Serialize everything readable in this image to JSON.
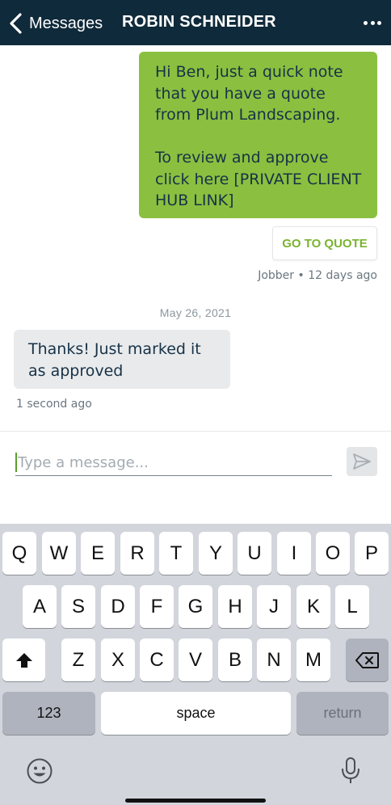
{
  "header": {
    "back_label": "Messages",
    "title": "ROBIN SCHNEIDER"
  },
  "conversation": {
    "outgoing_message": "Hi Ben, just a quick note that you have a quote from Plum Landscaping.\n\nTo review and approve click here [PRIVATE CLIENT HUB LINK]",
    "quote_button_label": "GO TO QUOTE",
    "outgoing_meta": "Jobber • 12 days ago",
    "date_separator": "May 26, 2021",
    "incoming_message": "Thanks! Just marked it as approved",
    "incoming_meta": "1 second ago"
  },
  "composer": {
    "placeholder": "Type a message..."
  },
  "keyboard": {
    "row1": [
      "Q",
      "W",
      "E",
      "R",
      "T",
      "Y",
      "U",
      "I",
      "O",
      "P"
    ],
    "row2": [
      "A",
      "S",
      "D",
      "F",
      "G",
      "H",
      "J",
      "K",
      "L"
    ],
    "row3": [
      "Z",
      "X",
      "C",
      "V",
      "B",
      "N",
      "M"
    ],
    "numbers_label": "123",
    "space_label": "space",
    "return_label": "return"
  },
  "colors": {
    "header_bg": "#0f2a3a",
    "outgoing_bubble": "#8bbf3f",
    "accent_green": "#7ab32e",
    "incoming_bubble": "#e8eaec",
    "keyboard_bg": "#d2d5db"
  },
  "icons": [
    "back-chevron-icon",
    "more-icon",
    "send-icon",
    "shift-icon",
    "backspace-icon",
    "emoji-icon",
    "microphone-icon"
  ]
}
